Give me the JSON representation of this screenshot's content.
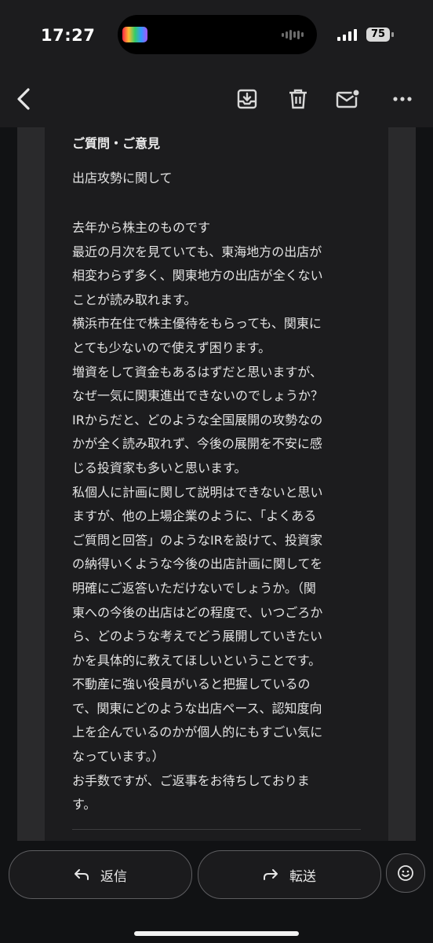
{
  "status_bar": {
    "time": "17:27",
    "battery": "75"
  },
  "toolbar": {
    "back_icon": "chevron-left-icon",
    "archive_icon": "archive-icon",
    "delete_icon": "trash-icon",
    "mark_unread_icon": "mail-unread-icon",
    "more_icon": "more-horizontal-icon"
  },
  "message": {
    "section_title": "ご質問・ご意見",
    "subject": "出店攻勢に関して",
    "body_lines": [
      "去年から株主のものです",
      "最近の月次を見ていても、東海地方の出店が",
      "相変わらず多く、関東地方の出店が全くない",
      "ことが読み取れます。",
      "横浜市在住で株主優待をもらっても、関東に",
      "とても少ないので使えず困ります。",
      "増資をして資金もあるはずだと思いますが、",
      "なぜ一気に関東進出できないのでしょうか？",
      "IRからだと、どのような全国展開の攻勢なの",
      "かが全く読み取れず、今後の展開を不安に感",
      "じる投資家も多いと思います。",
      "私個人に計画に関して説明はできないと思い",
      "ますが、他の上場企業のように、「よくある",
      "ご質問と回答」のようなIRを設けて、投資家",
      "の納得いくような今後の出店計画に関してを",
      "明確にご返答いただけないでしょうか。（関",
      "東への今後の出店はどの程度で、いつごろか",
      "ら、どのような考えでどう展開していきたい",
      "かを具体的に教えてほしいということです。",
      "不動産に強い役員がいると把握しているの",
      "で、関東にどのような出店ペース、認知度向",
      "上を企んでいるのかが個人的にもすごい気に",
      "なっています。）",
      "お手数ですが、ご返事をお待ちしておりま",
      "す。"
    ]
  },
  "actions": {
    "reply_label": "返信",
    "forward_label": "転送",
    "reply_icon": "reply-arrow-icon",
    "forward_icon": "forward-arrow-icon",
    "emoji_icon": "smiley-icon"
  },
  "colors": {
    "background": "#111214",
    "surface": "#1c1c1e",
    "text": "#e3e3e3",
    "border": "#5d5d60"
  }
}
